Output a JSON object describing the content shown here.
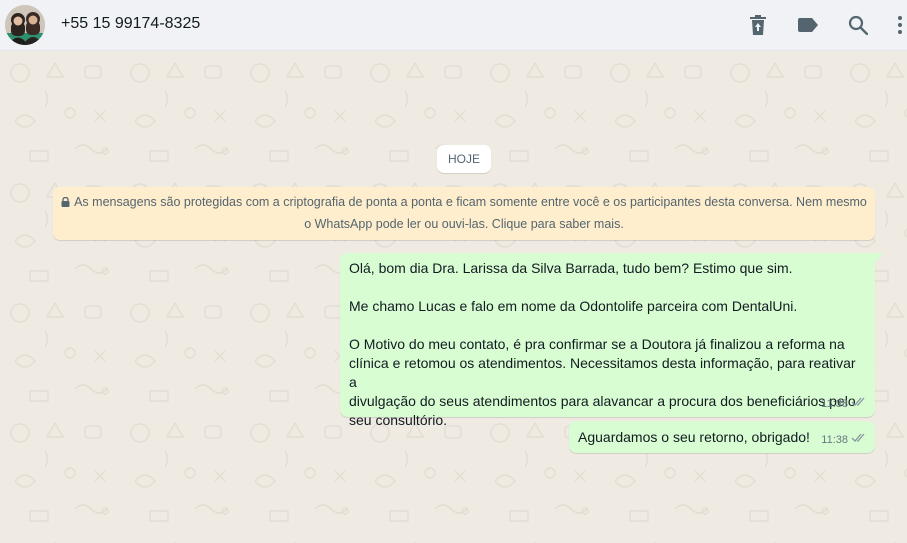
{
  "header": {
    "contact_name": "+55 15 99174-8325",
    "icons": [
      "delete-icon",
      "label-icon",
      "search-icon",
      "more-icon"
    ]
  },
  "chat": {
    "date_label": "HOJE",
    "encryption_notice": {
      "line1": "As mensagens são protegidas com a criptografia de ponta a ponta e ficam somente entre você e os participantes desta conversa. Nem mesmo",
      "line2": "o WhatsApp pode ler ou ouvi-las. Clique para saber mais."
    },
    "messages": [
      {
        "lines": [
          "Olá, bom dia Dra. Larissa da Silva Barrada, tudo bem? Estimo que sim.",
          "",
          "Me chamo Lucas e falo em nome da Odontolife parceira com DentalUni.",
          "",
          "O Motivo do meu contato, é pra confirmar se a Doutora já finalizou a reforma na",
          "clínica e retomou os atendimentos. Necessitamos desta informação, para reativar a",
          "divulgação do seus atendimentos para alavancar a procura dos beneficiários pelo",
          "seu consultório."
        ],
        "time": "11:38"
      },
      {
        "lines": [
          "Aguardamos o seu retorno, obrigado!"
        ],
        "time": "11:38"
      }
    ]
  },
  "colors": {
    "header_bg": "#f0f2f5",
    "chat_bg": "#efeae2",
    "outgoing_bubble": "#d9fdd3",
    "notice_bg": "#ffeecd",
    "icon": "#54656f"
  }
}
